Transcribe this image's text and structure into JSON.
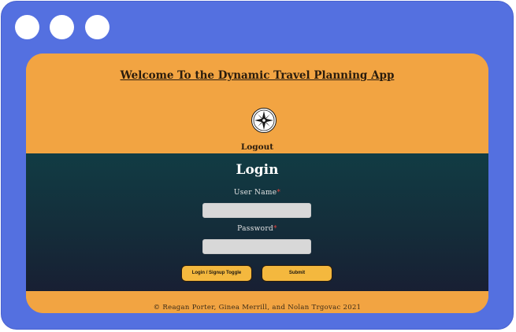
{
  "window": {
    "controls": [
      "circle",
      "circle",
      "circle"
    ]
  },
  "header": {
    "title": "Welcome To the Dynamic Travel Planning App",
    "logo_icon": "compass-icon",
    "logout_label": "Logout"
  },
  "login": {
    "heading": "Login",
    "username_label": "User Name",
    "password_label": "Password",
    "required_marker": "*",
    "username_value": "",
    "password_value": "",
    "toggle_button": "Login / Signup Toggle",
    "submit_button": "Submit"
  },
  "footer": {
    "text": "© Reagan Porter, Ginea Merrill, and Nolan Trgovac 2021"
  },
  "colors": {
    "frame": "#5470e0",
    "accent": "#f2a442",
    "panel_top": "#113c44",
    "panel_bottom": "#181f33",
    "button": "#f4b83e",
    "required": "#e0403a"
  }
}
